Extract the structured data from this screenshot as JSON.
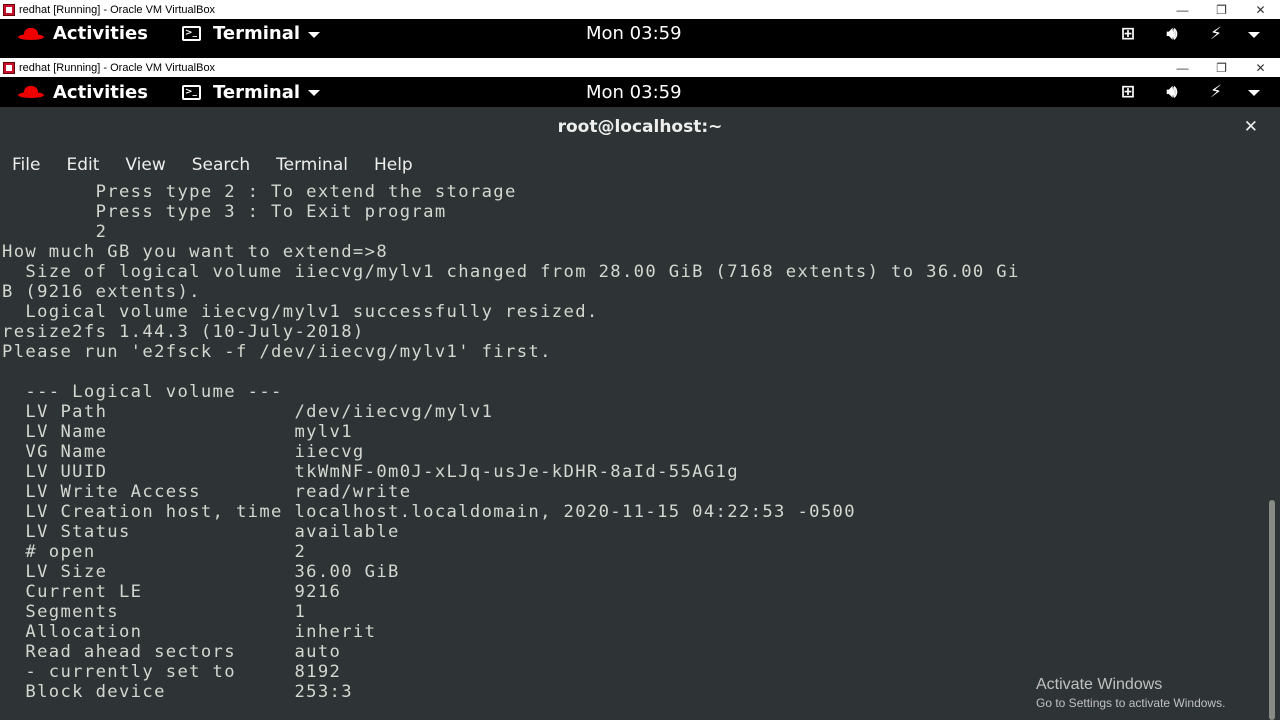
{
  "outer": {
    "caption": "redhat [Running] - Oracle VM VirtualBox",
    "controls": [
      "—",
      "❐",
      "✕"
    ]
  },
  "outer_bar": {
    "activities": "Activities",
    "app": "Terminal",
    "clock": "Mon 03:59"
  },
  "inner": {
    "caption": "redhat [Running] - Oracle VM VirtualBox",
    "controls": [
      "—",
      "❐",
      "✕"
    ]
  },
  "inner_bar": {
    "activities": "Activities",
    "app": "Terminal",
    "clock": "Mon 03:59"
  },
  "tray_icons": [
    "network-icon",
    "volume-icon",
    "power-icon"
  ],
  "terminal": {
    "title": "root@localhost:~",
    "close": "✕",
    "menu": [
      "File",
      "Edit",
      "View",
      "Search",
      "Terminal",
      "Help"
    ],
    "lines": [
      "        Press type 2 : To extend the storage",
      "        Press type 3 : To Exit program",
      "        2",
      "How much GB you want to extend=>8",
      "  Size of logical volume iiecvg/mylv1 changed from 28.00 GiB (7168 extents) to 36.00 Gi",
      "B (9216 extents).",
      "  Logical volume iiecvg/mylv1 successfully resized.",
      "resize2fs 1.44.3 (10-July-2018)",
      "Please run 'e2fsck -f /dev/iiecvg/mylv1' first.",
      "",
      "  --- Logical volume ---",
      "  LV Path                /dev/iiecvg/mylv1",
      "  LV Name                mylv1",
      "  VG Name                iiecvg",
      "  LV UUID                tkWmNF-0m0J-xLJq-usJe-kDHR-8aId-55AG1g",
      "  LV Write Access        read/write",
      "  LV Creation host, time localhost.localdomain, 2020-11-15 04:22:53 -0500",
      "  LV Status              available",
      "  # open                 2",
      "  LV Size                36.00 GiB",
      "  Current LE             9216",
      "  Segments               1",
      "  Allocation             inherit",
      "  Read ahead sectors     auto",
      "  - currently set to     8192",
      "  Block device           253:3"
    ]
  },
  "watermark": {
    "line1": "Activate Windows",
    "line2": "Go to Settings to activate Windows."
  }
}
